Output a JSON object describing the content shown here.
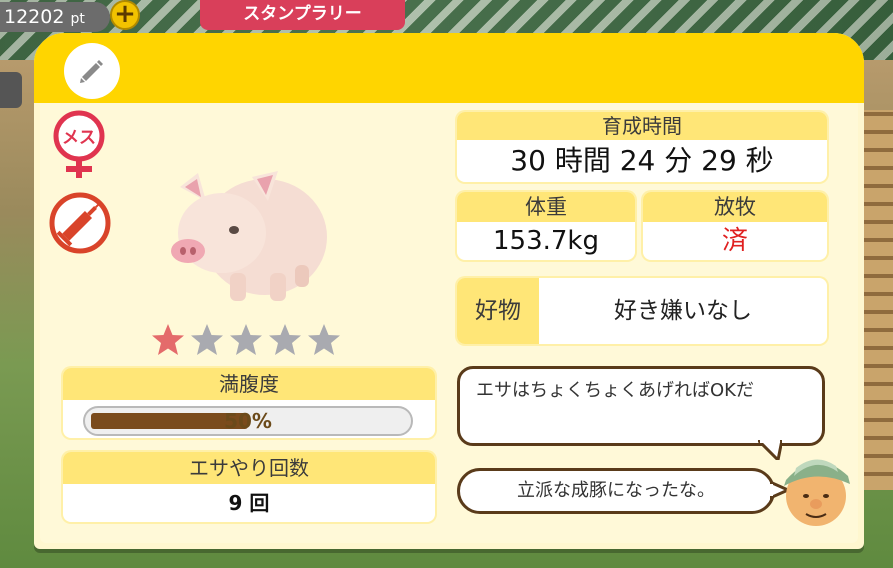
{
  "hud": {
    "points_value": "12202",
    "points_unit": "pt",
    "plus_label": "+",
    "banner_text": "スタンプラリー"
  },
  "header": {
    "edit_icon": "pencil-icon"
  },
  "pig": {
    "gender_icon": "female-icon",
    "gender_label": "メス",
    "vaccine_icon": "syringe-icon",
    "rating": 1,
    "rating_max": 5
  },
  "hunger": {
    "label": "満腹度",
    "value_text": "50%",
    "fraction": 0.5
  },
  "feeding": {
    "label": "エサやり回数",
    "value": "9 回"
  },
  "growth_time": {
    "label": "育成時間",
    "value": "30 時間 24 分 29 秒"
  },
  "weight": {
    "label": "体重",
    "value": "153.7kg"
  },
  "grazing": {
    "label": "放牧",
    "value": "済"
  },
  "favorite": {
    "label": "好物",
    "value": "好き嫌いなし"
  },
  "dialogue": {
    "line1": "エサはちょくちょくあげればOKだ",
    "line2": "立派な成豚になったな。"
  },
  "colors": {
    "header_yellow": "#ffd500",
    "card_bg": "#fff7cf",
    "label_bg": "#ffe677",
    "done_red": "#e02020",
    "bar_fill": "#7a4b1c"
  }
}
